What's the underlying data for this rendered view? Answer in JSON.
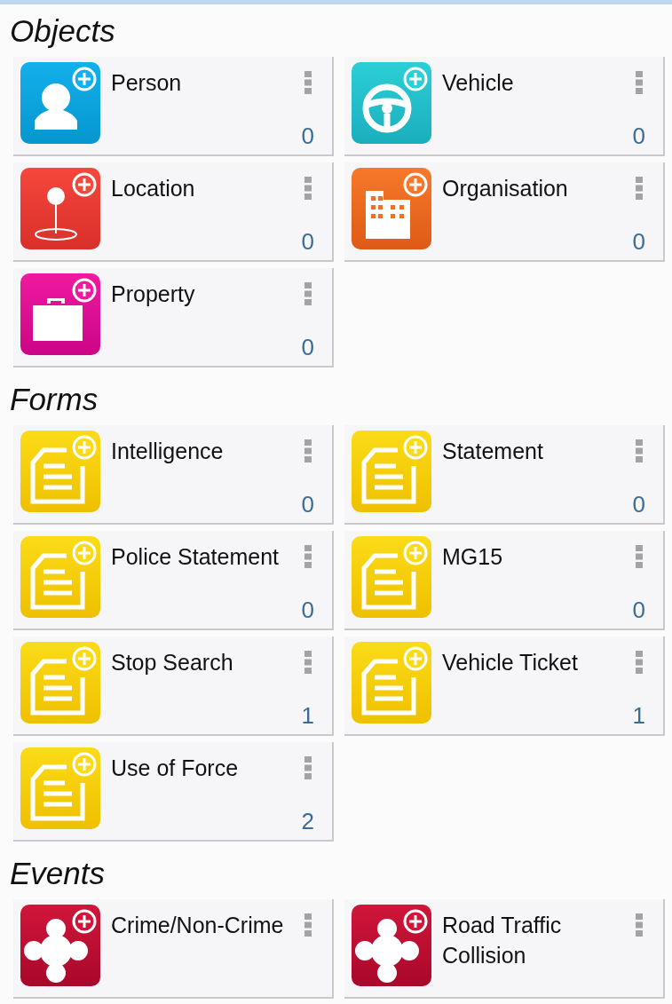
{
  "sections": [
    {
      "title": "Objects",
      "items": [
        {
          "kind": "person",
          "label": "Person",
          "count": "0"
        },
        {
          "kind": "vehicle",
          "label": "Vehicle",
          "count": "0"
        },
        {
          "kind": "location",
          "label": "Location",
          "count": "0"
        },
        {
          "kind": "organisation",
          "label": "Organisation",
          "count": "0"
        },
        {
          "kind": "property",
          "label": "Property",
          "count": "0"
        }
      ]
    },
    {
      "title": "Forms",
      "items": [
        {
          "kind": "form",
          "label": "Intelligence",
          "count": "0"
        },
        {
          "kind": "form",
          "label": "Statement",
          "count": "0"
        },
        {
          "kind": "form",
          "label": "Police Statement",
          "count": "0"
        },
        {
          "kind": "form",
          "label": "MG15",
          "count": "0"
        },
        {
          "kind": "form",
          "label": "Stop Search",
          "count": "1"
        },
        {
          "kind": "form",
          "label": "Vehicle Ticket",
          "count": "1"
        },
        {
          "kind": "form",
          "label": "Use of Force",
          "count": "2"
        }
      ]
    },
    {
      "title": "Events",
      "items": [
        {
          "kind": "event",
          "label": "Crime/Non-Crime"
        },
        {
          "kind": "event",
          "label": "Road Traffic Collision"
        }
      ]
    }
  ]
}
